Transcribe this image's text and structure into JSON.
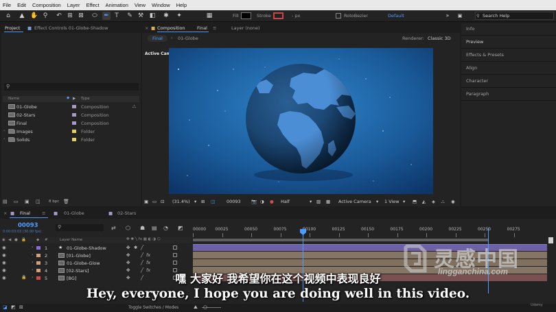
{
  "menu": [
    "File",
    "Edit",
    "Composition",
    "Layer",
    "Effect",
    "Animation",
    "View",
    "Window",
    "Help"
  ],
  "toolbar": {
    "fill_label": "Fill",
    "stroke_label": "Stroke",
    "stroke_unit": "- px",
    "rotobezier_label": "RotoBezier",
    "workspace": "Default",
    "search_placeholder": "Search Help"
  },
  "project_panel": {
    "tab_project": "Project",
    "tab_effect_controls": "Effect Controls 01-Globe-Shadow",
    "col_name": "Name",
    "col_type": "Type",
    "items": [
      {
        "name": "01-Globe",
        "type": "Composition",
        "color": "#a79ac7",
        "kind": "comp"
      },
      {
        "name": "02-Stars",
        "type": "Composition",
        "color": "#a79ac7",
        "kind": "comp"
      },
      {
        "name": "Final",
        "type": "Composition",
        "color": "#a79ac7",
        "kind": "comp"
      },
      {
        "name": "Images",
        "type": "Folder",
        "color": "#e3d35a",
        "kind": "folder"
      },
      {
        "name": "Solids",
        "type": "Folder",
        "color": "#e3d35a",
        "kind": "folder"
      }
    ],
    "bpc": "8 bpc"
  },
  "comp_panel": {
    "tab_prefix": "Composition",
    "tab_name": "Final",
    "tab_layer": "Layer (none)",
    "sub_tab_final": "Final",
    "sub_tab_globe": "01-Globe",
    "renderer_label": "Renderer:",
    "renderer_value": "Classic 3D",
    "active_camera": "Active Camera",
    "zoom": "(31.4%)",
    "timecode": "00093",
    "resolution": "Half",
    "camera": "Active Camera",
    "views": "1 View"
  },
  "right_panels": [
    "Info",
    "Preview",
    "Effects & Presets",
    "Align",
    "Character",
    "Paragraph"
  ],
  "timeline": {
    "tab_final": "Final",
    "tab_globe": "01-Globe",
    "tab_stars": "02-Stars",
    "timecode": "00093",
    "fps": "0:00:03:03 (30.00 fps)",
    "header_layer_name": "Layer Name",
    "ticks": [
      "00000",
      "00025",
      "00050",
      "00075",
      "00100",
      "00125",
      "00150",
      "00175",
      "00200",
      "00225",
      "00250",
      "00275"
    ],
    "layers": [
      {
        "num": "1",
        "name": "01-Globe-Shadow",
        "color": "#8a6fe0",
        "bar": "#7a6fb8",
        "fx": false,
        "lock": false
      },
      {
        "num": "2",
        "name": "[01-Globe]",
        "color": "#d4a07a",
        "bar": "#8a7868",
        "fx": true,
        "lock": false
      },
      {
        "num": "3",
        "name": "01-Globe-Glow",
        "color": "#d4a07a",
        "bar": "#8a7868",
        "fx": true,
        "lock": false
      },
      {
        "num": "4",
        "name": "[02-Stars]",
        "color": "#d4a07a",
        "bar": "#8a7868",
        "fx": true,
        "lock": false
      },
      {
        "num": "5",
        "name": "[BG]",
        "color": "#d44a4a",
        "bar": "#7a5050",
        "fx": false,
        "lock": true
      }
    ],
    "toggle_label": "Toggle Switches / Modes"
  },
  "watermark": {
    "cn": "灵感中国",
    "url": "lingganchina.com"
  },
  "subtitles": {
    "cn": "嘿 大家好 我希望你在这个视频中表现良好",
    "en": "Hey, everyone, I hope you are doing well in this video."
  },
  "udemy": "Udemy"
}
